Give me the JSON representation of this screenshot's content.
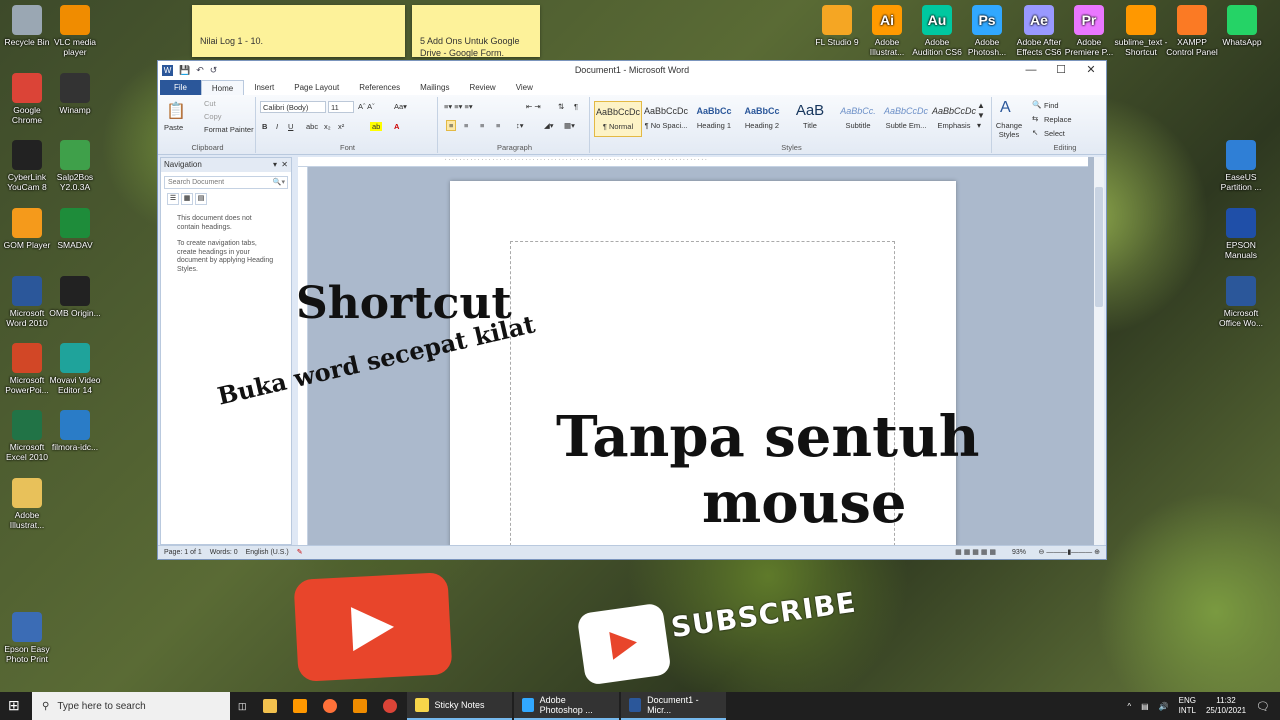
{
  "desktop": {
    "left_icons": [
      {
        "label": "Recycle Bin",
        "icon": "recycle-bin-icon",
        "color": "#9aa7b3"
      },
      {
        "label": "Google Chrome",
        "icon": "chrome-icon",
        "color": "#db4437"
      },
      {
        "label": "CyberLink YouCam 8",
        "icon": "youcam-icon",
        "color": "#222222"
      },
      {
        "label": "GOM Player",
        "icon": "gom-player-icon",
        "color": "#f59a1b"
      },
      {
        "label": "Microsoft Word 2010",
        "icon": "word-icon",
        "color": "#2b579a"
      },
      {
        "label": "Microsoft PowerPoi...",
        "icon": "powerpoint-icon",
        "color": "#d24726"
      },
      {
        "label": "Microsoft Excel 2010",
        "icon": "excel-icon",
        "color": "#217346"
      },
      {
        "label": "Adobe Illustrat...",
        "icon": "folder-icon",
        "color": "#e8c15a"
      },
      {
        "label": "Epson Easy Photo Print",
        "icon": "epson-photo-icon",
        "color": "#3b6cb5"
      }
    ],
    "second_col_icons": [
      {
        "label": "VLC media player",
        "icon": "vlc-icon",
        "color": "#f08c00"
      },
      {
        "label": "Winamp",
        "icon": "winamp-icon",
        "color": "#333333"
      },
      {
        "label": "Salp2Bos Y2.0.3A",
        "icon": "salp-icon",
        "color": "#3fa04a"
      },
      {
        "label": "SMADAV",
        "icon": "smadav-icon",
        "color": "#1e8c3a"
      },
      {
        "label": "OMB Origin...",
        "icon": "omb-icon",
        "color": "#222222"
      },
      {
        "label": "Movavi Video Editor 14",
        "icon": "movavi-icon",
        "color": "#1fa39b"
      },
      {
        "label": "filmora-idc...",
        "icon": "filmora-icon",
        "color": "#2a7cc7"
      }
    ],
    "top_right_icons": [
      {
        "label": "FL Studio 9",
        "icon": "fl-studio-icon",
        "color": "#f5a623",
        "abbr": ""
      },
      {
        "label": "Adobe Illustrat...",
        "icon": "illustrator-icon",
        "color": "#ff9a00",
        "abbr": "Ai"
      },
      {
        "label": "Adobe Audition CS6",
        "icon": "audition-icon",
        "color": "#00c8a0",
        "abbr": "Au"
      },
      {
        "label": "Adobe Photosh...",
        "icon": "photoshop-icon",
        "color": "#31a8ff",
        "abbr": "Ps"
      },
      {
        "label": "Adobe After Effects CS6",
        "icon": "after-effects-icon",
        "color": "#9999ff",
        "abbr": "Ae"
      },
      {
        "label": "Adobe Premiere P...",
        "icon": "premiere-icon",
        "color": "#ea77ff",
        "abbr": "Pr"
      },
      {
        "label": "sublime_text - Shortcut",
        "icon": "sublime-icon",
        "color": "#ff9800",
        "abbr": ""
      },
      {
        "label": "XAMPP Control Panel",
        "icon": "xampp-icon",
        "color": "#fb7a24",
        "abbr": ""
      },
      {
        "label": "WhatsApp",
        "icon": "whatsapp-icon",
        "color": "#25d366",
        "abbr": ""
      }
    ],
    "right_col_icons": [
      {
        "label": "EaseUS Partition ...",
        "icon": "easeus-icon",
        "color": "#2f7fd6"
      },
      {
        "label": "EPSON Manuals",
        "icon": "epson-manuals-icon",
        "color": "#1f4fa8"
      },
      {
        "label": "Microsoft Office Wo...",
        "icon": "word-doc-icon",
        "color": "#2b579a"
      }
    ],
    "sticky_notes": [
      {
        "text": "Nilai Log 1 - 10."
      },
      {
        "text": "5 Add Ons Untuk Google Drive - Google Form."
      }
    ]
  },
  "word": {
    "title": "Document1 - Microsoft Word",
    "tabs": [
      "File",
      "Home",
      "Insert",
      "Page Layout",
      "References",
      "Mailings",
      "Review",
      "View"
    ],
    "clipboard": {
      "paste": "Paste",
      "cut": "Cut",
      "copy": "Copy",
      "format_painter": "Format Painter",
      "label": "Clipboard"
    },
    "font": {
      "name": "Calibri (Body)",
      "size": "11",
      "label": "Font"
    },
    "paragraph_label": "Paragraph",
    "styles": [
      {
        "preview": "AaBbCcDc",
        "name": "¶ Normal"
      },
      {
        "preview": "AaBbCcDc",
        "name": "¶ No Spaci..."
      },
      {
        "preview": "AaBbCc",
        "name": "Heading 1"
      },
      {
        "preview": "AaBbCc",
        "name": "Heading 2"
      },
      {
        "preview": "AaB",
        "name": "Title"
      },
      {
        "preview": "AaBbCc.",
        "name": "Subtitle"
      },
      {
        "preview": "AaBbCcDc",
        "name": "Subtle Em..."
      },
      {
        "preview": "AaBbCcDc",
        "name": "Emphasis"
      }
    ],
    "styles_label": "Styles",
    "change_styles": "Change Styles",
    "editing": {
      "find": "Find",
      "replace": "Replace",
      "select": "Select",
      "label": "Editing"
    },
    "nav": {
      "title": "Navigation",
      "search_placeholder": "Search Document",
      "msg1": "This document does not contain headings.",
      "msg2": "To create navigation tabs, create headings in your document by applying Heading Styles."
    },
    "status": {
      "page": "Page: 1 of 1",
      "words": "Words: 0",
      "lang": "English (U.S.)",
      "zoom": "93%"
    }
  },
  "overlay": {
    "shortcut": "Shortcut",
    "buka": "Buka word secepat kilat",
    "tanpa": "Tanpa sentuh",
    "mouse": "mouse",
    "subscribe": "SUBSCRIBE"
  },
  "taskbar": {
    "search_placeholder": "Type here to search",
    "items": [
      {
        "label": "Sticky Notes",
        "icon": "sticky-notes-icon",
        "color": "#f7d54a"
      },
      {
        "label": "Adobe Photoshop ...",
        "icon": "photoshop-task-icon",
        "color": "#31a8ff"
      },
      {
        "label": "Document1 - Micr...",
        "icon": "word-task-icon",
        "color": "#2b579a"
      }
    ],
    "lang1": "ENG",
    "lang2": "INTL",
    "time": "11:32",
    "date": "25/10/2021"
  }
}
